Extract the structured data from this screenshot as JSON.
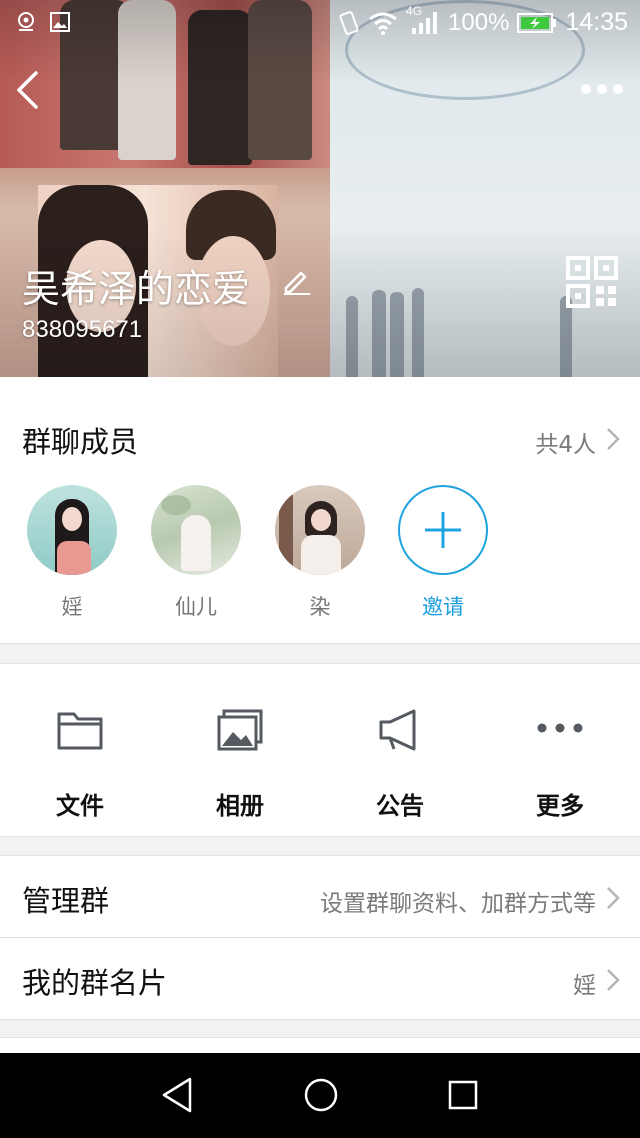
{
  "status_bar": {
    "network": "4G",
    "battery": "100%",
    "time": "14:35"
  },
  "header": {
    "group_name": "吴希泽的恋爱",
    "group_id": "838095671"
  },
  "members": {
    "title": "群聊成员",
    "count": "共4人",
    "list": [
      {
        "name": "婬"
      },
      {
        "name": "仙儿"
      },
      {
        "name": "染"
      }
    ],
    "invite_label": "邀请"
  },
  "actions": [
    {
      "label": "文件",
      "icon": "folder-icon"
    },
    {
      "label": "相册",
      "icon": "album-icon"
    },
    {
      "label": "公告",
      "icon": "megaphone-icon"
    },
    {
      "label": "更多",
      "icon": "more-dots-icon"
    }
  ],
  "rows": {
    "manage": {
      "label": "管理群",
      "value": "设置群聊资料、加群方式等"
    },
    "card": {
      "label": "我的群名片",
      "value": "婬"
    }
  },
  "colors": {
    "accent": "#1ea3e0",
    "icon": "#555a61"
  }
}
